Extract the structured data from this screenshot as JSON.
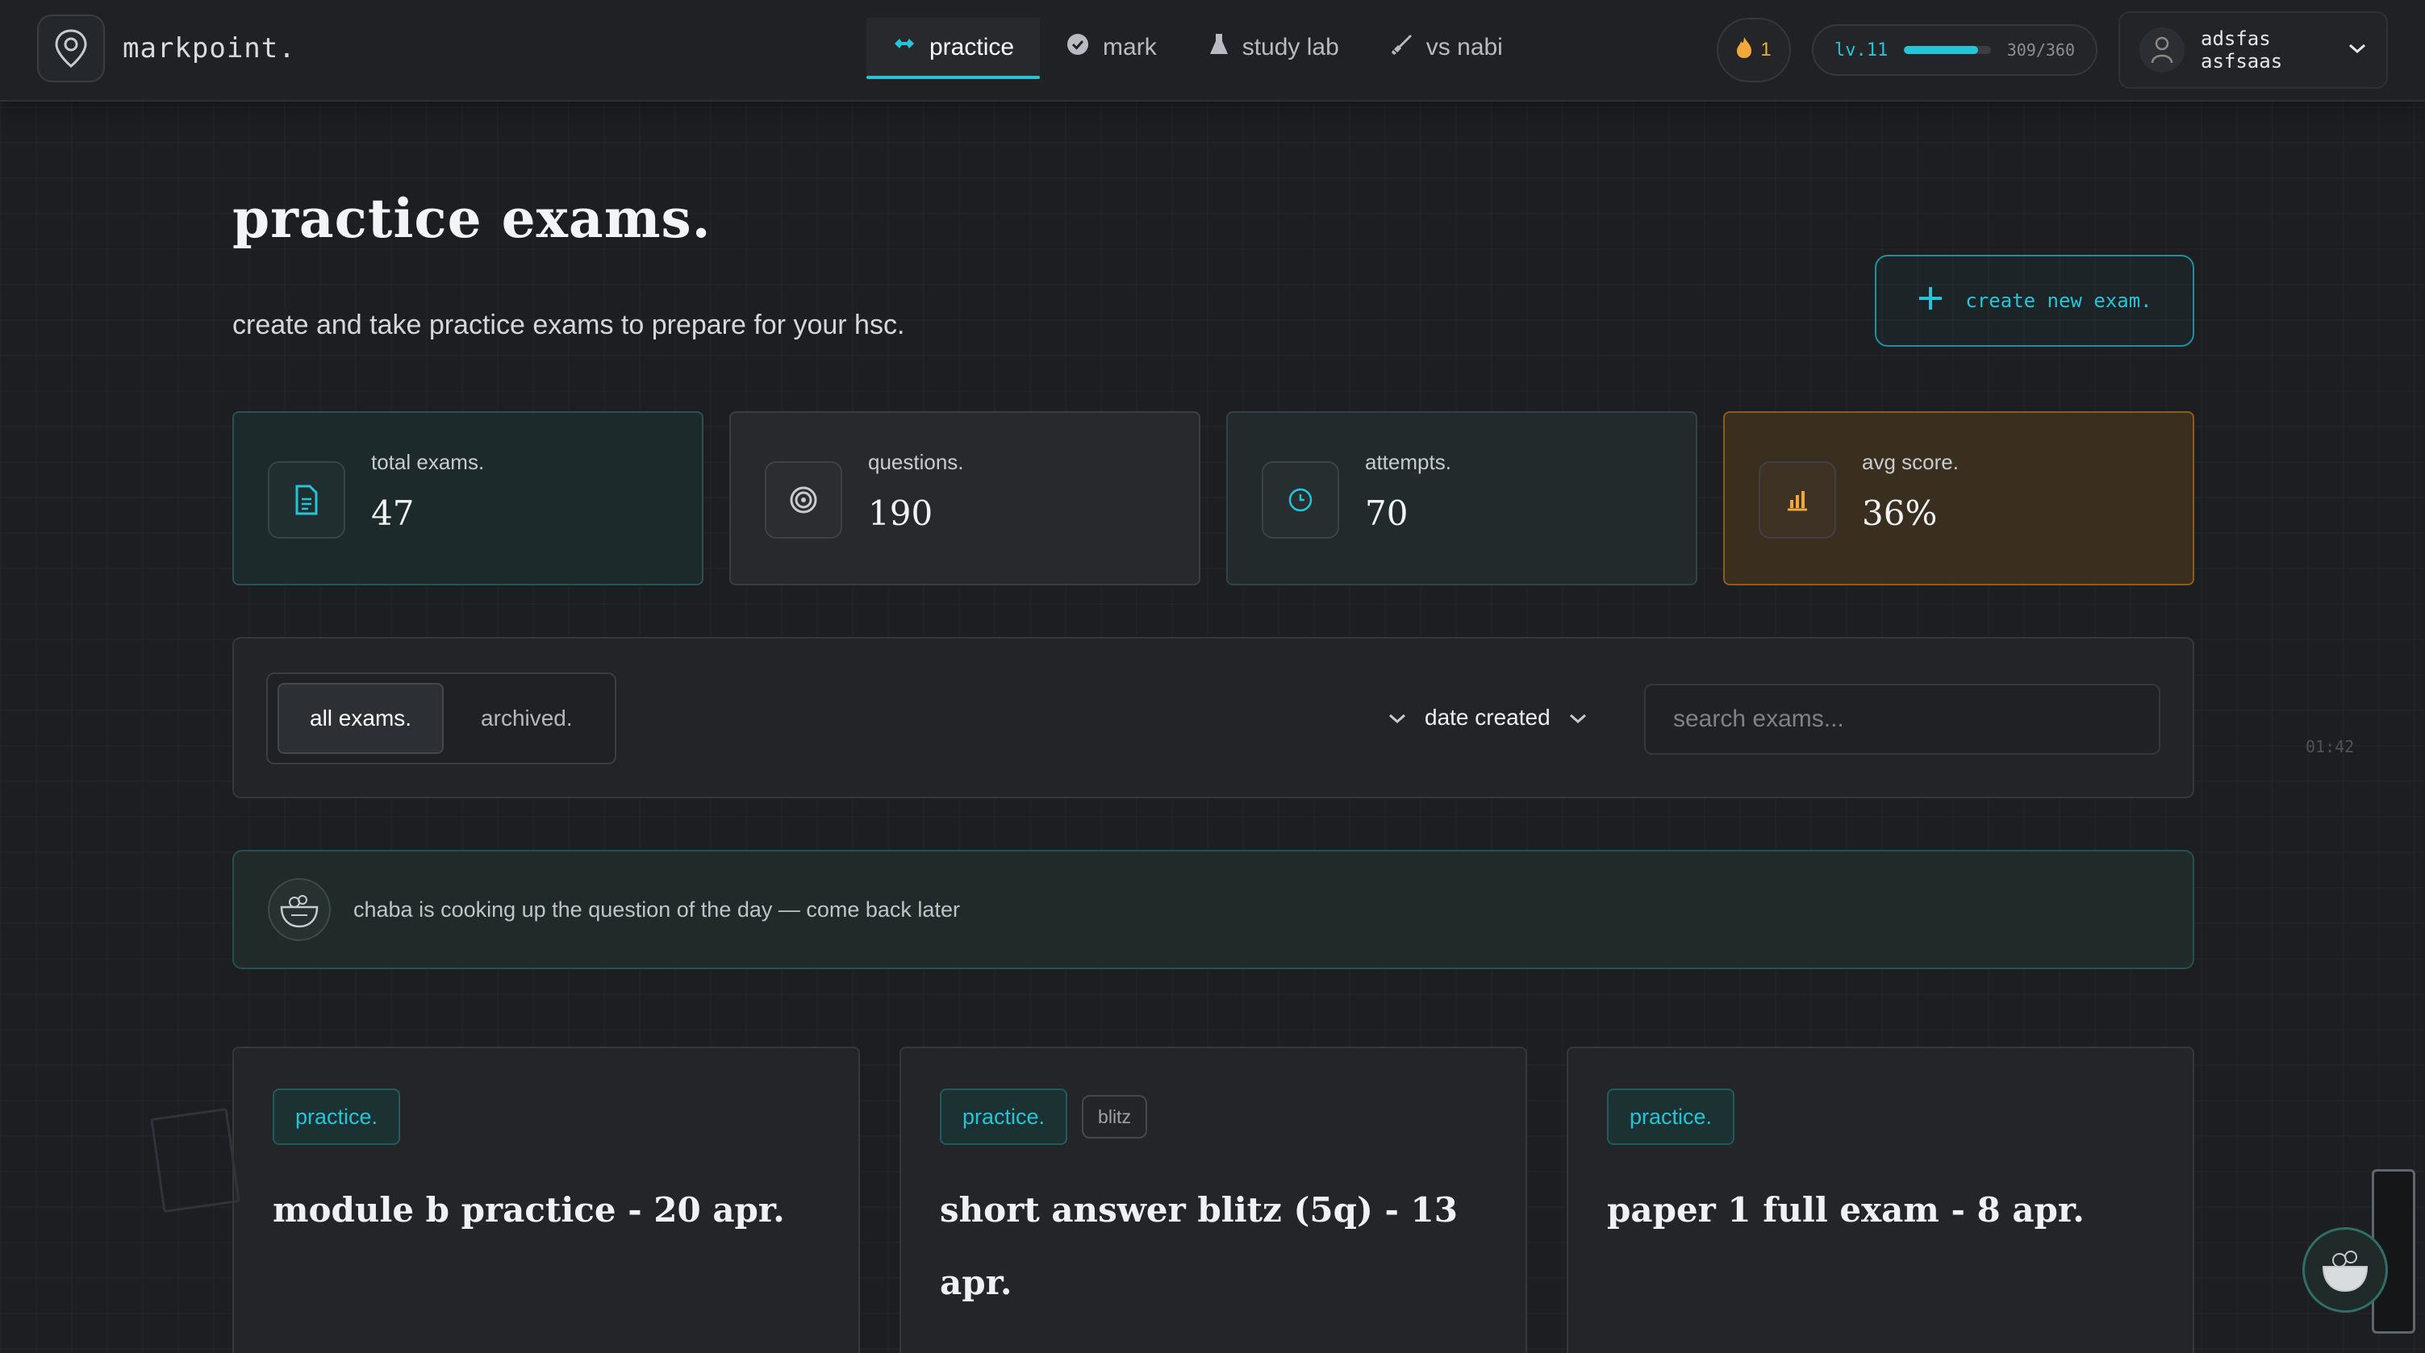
{
  "app": {
    "brand": "markpoint."
  },
  "nav": {
    "tabs": [
      {
        "label": "practice",
        "icon": "gamepad-icon",
        "active": true
      },
      {
        "label": "mark",
        "icon": "check-circle-icon",
        "active": false
      },
      {
        "label": "study lab",
        "icon": "flask-icon",
        "active": false
      },
      {
        "label": "vs nabi",
        "icon": "sword-icon",
        "active": false
      }
    ],
    "streak": "1",
    "level": {
      "label": "lv.11",
      "xp_text": "309/360",
      "progress": 0.858
    },
    "user": {
      "name": "adsfas asfsaas"
    }
  },
  "header": {
    "title": "practice exams.",
    "subtitle": "create and take practice exams to prepare for your hsc.",
    "create_label": "create new exam."
  },
  "stats": [
    {
      "label": "total exams.",
      "value": "47",
      "icon": "document-icon",
      "color": "#27c4d8"
    },
    {
      "label": "questions.",
      "value": "190",
      "icon": "target-icon",
      "color": "#c8cbd0"
    },
    {
      "label": "attempts.",
      "value": "70",
      "icon": "clock-icon",
      "color": "#27c4d8"
    },
    {
      "label": "avg score.",
      "value": "36%",
      "icon": "bar-chart-icon",
      "color": "#f2a93b"
    }
  ],
  "filters": {
    "tabs": [
      "all exams.",
      "archived."
    ],
    "sort_label": "date created",
    "search_placeholder": "search exams..."
  },
  "timer": "01:42",
  "qotd": {
    "text": "chaba is cooking up the question of the day — come back later"
  },
  "exams": [
    {
      "tags": [
        "practice."
      ],
      "title": "module b practice - 20 apr."
    },
    {
      "tags": [
        "practice.",
        "blitz"
      ],
      "title": "short answer blitz (5q) - 13 apr."
    },
    {
      "tags": [
        "practice."
      ],
      "title": "paper 1 full exam - 8 apr."
    }
  ],
  "colors": {
    "accent": "#27c4d8",
    "amber": "#f2a93b",
    "background": "#1c1e21"
  }
}
